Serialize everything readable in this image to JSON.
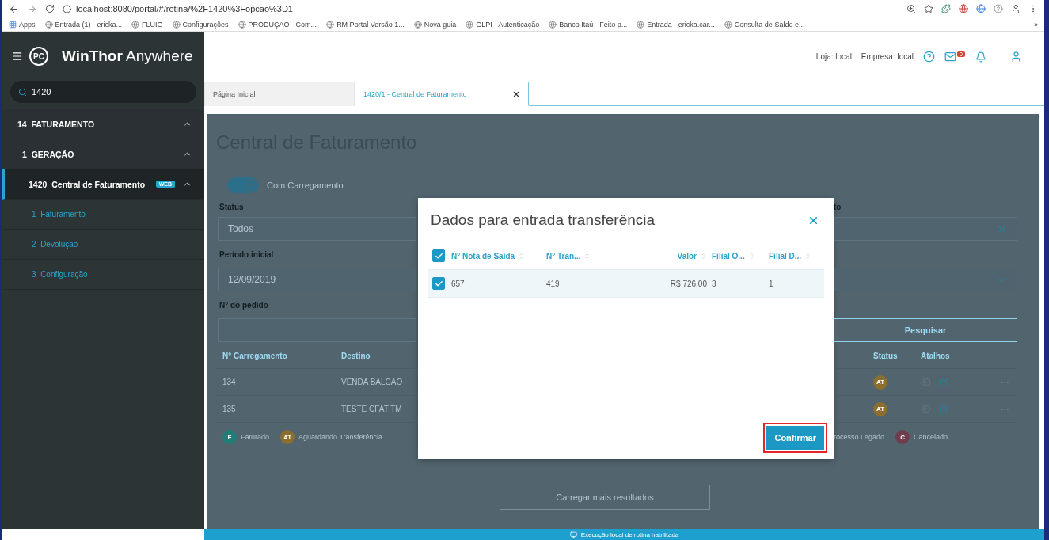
{
  "browser": {
    "url": "localhost:8080/portal/#/rotina/%2F1420%3Fopcao%3D1",
    "bookmarks": [
      {
        "label": "Apps"
      },
      {
        "label": "Entrada (1) - ericka..."
      },
      {
        "label": "FLUIG"
      },
      {
        "label": "Configurações"
      },
      {
        "label": "PRODUÇÃO - Com..."
      },
      {
        "label": "RM Portal Versão 1..."
      },
      {
        "label": "Nova guia"
      },
      {
        "label": "GLPI - Autenticação"
      },
      {
        "label": "Banco Itaú - Feito p..."
      },
      {
        "label": "Entrada - ericka.car..."
      },
      {
        "label": "Consulta de Saldo e..."
      }
    ],
    "more": "»"
  },
  "sidebar": {
    "logo_mark": "PC",
    "brand_bold": "WinThor",
    "brand_light": "Anywhere",
    "search": {
      "value": "1420"
    },
    "menu": [
      {
        "code": "14",
        "label": "FATURAMENTO",
        "expanded": true,
        "selected": false,
        "children": [
          {
            "code": "1",
            "label": "GERAÇÃO",
            "expanded": true,
            "selected": false,
            "children": [
              {
                "code": "1420",
                "label": "Central de Faturamento",
                "badge": "WEB",
                "expanded": true,
                "selected": true,
                "children": [
                  {
                    "code": "1",
                    "label": "Faturamento",
                    "selected": false
                  },
                  {
                    "code": "2",
                    "label": "Devolução",
                    "selected": false
                  },
                  {
                    "code": "3",
                    "label": "Configuração",
                    "selected": false
                  }
                ]
              }
            ]
          }
        ]
      }
    ]
  },
  "header": {
    "store": "Loja: local",
    "company": "Empresa: local",
    "mail_count": "0"
  },
  "tabs": [
    {
      "label": "Página Inicial",
      "selected": false,
      "closable": false
    },
    {
      "label": "1420/1 - Central de Faturamento",
      "selected": true,
      "closable": true
    }
  ],
  "page": {
    "title": "Central de Faturamento",
    "toggle": {
      "label": "Com Carregamento",
      "on": true
    },
    "filters_left": [
      {
        "label": "Status",
        "value": "Todos"
      },
      {
        "label": "Período inicial",
        "value": "12/09/2019"
      },
      {
        "label": "N° do pedido"
      }
    ],
    "filters_right": [
      {
        "label": "to",
        "kind": "clearable"
      },
      {
        "kind": "dropdown"
      },
      {
        "kind": "button",
        "text": "Pesquisar"
      }
    ],
    "table": {
      "left_columns": [
        "N° Carregamento",
        "Destino"
      ],
      "right_columns": [
        "Status",
        "Atalhos"
      ],
      "rows": [
        {
          "number": "134",
          "destination": "VENDA BALCAO",
          "status": {
            "code": "AT",
            "color": "#8c6e2e"
          }
        },
        {
          "number": "135",
          "destination": "TESTE CFAT TM",
          "status": {
            "code": "AT",
            "color": "#8c6e2e"
          }
        }
      ]
    },
    "legend_left": [
      {
        "code": "F",
        "label": "Faturado",
        "color": "#1f7f78"
      },
      {
        "code": "AT",
        "label": "Aguardando Transferência",
        "color": "#8c6e2e"
      }
    ],
    "legend_right": [
      {
        "label": "rocesso Legado"
      },
      {
        "code": "C",
        "label": "Cancelado",
        "color": "#6e3d4e"
      }
    ],
    "load_more": "Carregar mais resultados"
  },
  "modal": {
    "title": "Dados para entrada transferência",
    "select_all": true,
    "columns": [
      "N° Nota de Saída",
      "N° Tran...",
      "Valor",
      "Filial O...",
      "Filial D..."
    ],
    "rows": [
      {
        "checked": true,
        "cells": [
          "657",
          "419",
          "R$ 726,00",
          "3",
          "1"
        ]
      }
    ],
    "confirm": "Confirmar"
  },
  "status_bar": "Execução local de rotina habilitada"
}
